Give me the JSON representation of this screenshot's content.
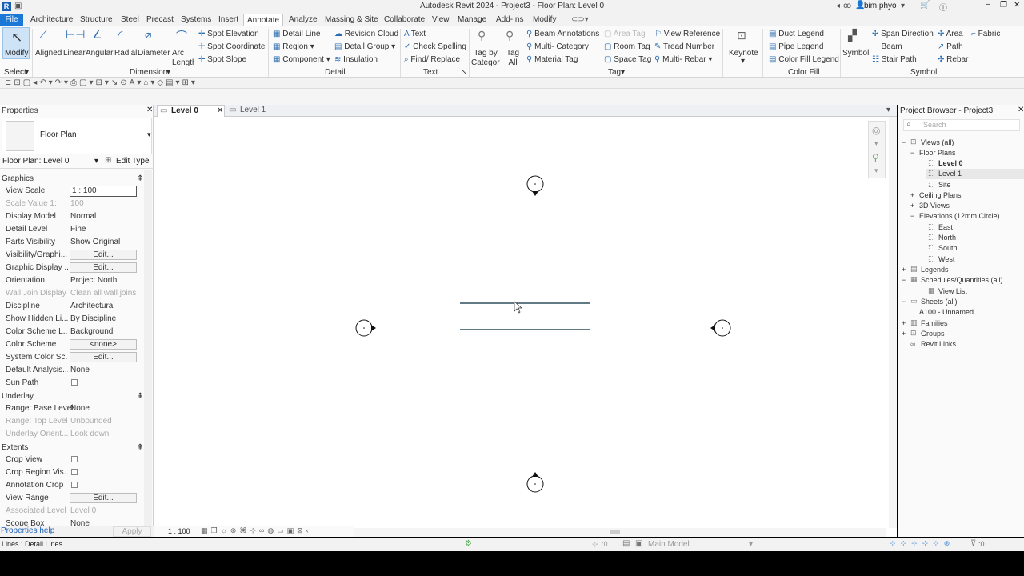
{
  "window": {
    "title": "Autodesk Revit 2024 - Project3 - Floor Plan: Level 0",
    "user": "bim.phyo"
  },
  "menu": [
    "File",
    "Architecture",
    "Structure",
    "Steel",
    "Precast",
    "Systems",
    "Insert",
    "Annotate",
    "Analyze",
    "Massing & Site",
    "Collaborate",
    "View",
    "Manage",
    "Add-Ins",
    "Modify"
  ],
  "ribbon": {
    "select_group": {
      "modify": "Modify",
      "label": "Select"
    },
    "dimension_group": {
      "items": [
        "Aligned",
        "Linear",
        "Angular",
        "Radial",
        "Diameter",
        "Arc Length"
      ],
      "spot": [
        "Spot Elevation",
        "Spot Coordinate",
        "Spot Slope"
      ],
      "label": "Dimension"
    },
    "detail_group": {
      "items": [
        "Detail Line",
        "Region",
        "Component",
        "Revision Cloud",
        "Detail Group",
        "Insulation"
      ],
      "label": "Detail"
    },
    "text_group": {
      "items": [
        "Text",
        "Check Spelling",
        "Find/ Replace"
      ],
      "label": "Text"
    },
    "tag_group": {
      "items": [
        "Tag by Category",
        "Tag All",
        "Beam Annotations",
        "Multi- Category",
        "Material Tag",
        "Area Tag",
        "Room Tag",
        "Space Tag",
        "Tread Number",
        "View Reference",
        "Multi- Rebar",
        "Keynote"
      ],
      "label": "Tag"
    },
    "colorfill_group": {
      "items": [
        "Duct Legend",
        "Pipe Legend",
        "Color Fill Legend"
      ],
      "label": "Color Fill"
    },
    "symbol_group": {
      "items": [
        "Symbol",
        "Span Direction",
        "Beam",
        "Stair Path",
        "Area",
        "Path",
        "Rebar",
        "Fabric"
      ],
      "label": "Symbol"
    }
  },
  "properties": {
    "title": "Properties",
    "type": "Floor Plan",
    "instance": "Floor Plan: Level 0",
    "edit_type": "Edit Type",
    "sections": {
      "graphics": "Graphics",
      "underlay": "Underlay",
      "extents": "Extents"
    },
    "rows": {
      "view_scale": [
        "View Scale",
        "1 : 100"
      ],
      "scale_value": [
        "Scale Value  1:",
        "100"
      ],
      "display_model": [
        "Display Model",
        "Normal"
      ],
      "detail_level": [
        "Detail Level",
        "Fine"
      ],
      "parts_visibility": [
        "Parts Visibility",
        "Show Original"
      ],
      "visibility_graphics": [
        "Visibility/Graphi...",
        "Edit..."
      ],
      "graphic_display": [
        "Graphic Display ...",
        "Edit..."
      ],
      "orientation": [
        "Orientation",
        "Project North"
      ],
      "wall_join": [
        "Wall Join Display",
        "Clean all wall joins"
      ],
      "discipline": [
        "Discipline",
        "Architectural"
      ],
      "show_hidden": [
        "Show Hidden Li...",
        "By Discipline"
      ],
      "color_scheme_loc": [
        "Color Scheme L...",
        "Background"
      ],
      "color_scheme": [
        "Color Scheme",
        "<none>"
      ],
      "system_color": [
        "System Color Sc...",
        "Edit..."
      ],
      "default_analysis": [
        "Default Analysis...",
        "None"
      ],
      "sun_path": [
        "Sun Path",
        ""
      ],
      "base_level": [
        "Range: Base Level",
        "None"
      ],
      "top_level": [
        "Range: Top Level",
        "Unbounded"
      ],
      "underlay_orient": [
        "Underlay Orient...",
        "Look down"
      ],
      "crop_view": [
        "Crop View",
        ""
      ],
      "crop_region": [
        "Crop Region Vis...",
        ""
      ],
      "annotation_crop": [
        "Annotation Crop",
        ""
      ],
      "view_range": [
        "View Range",
        "Edit..."
      ],
      "associated_level": [
        "Associated Level",
        "Level 0"
      ],
      "scope_box": [
        "Scope Box",
        "None"
      ]
    },
    "help": "Properties help",
    "apply": "Apply"
  },
  "view_tabs": [
    "Level 0",
    "Level 1"
  ],
  "view_scale_status": "1 : 100",
  "browser": {
    "title": "Project Browser - Project3",
    "search": "Search",
    "nodes": [
      "Views (all)",
      "Floor Plans",
      "Level 0",
      "Level 1",
      "Site",
      "Ceiling Plans",
      "3D Views",
      "Elevations (12mm Circle)",
      "East",
      "North",
      "South",
      "West",
      "Legends",
      "Schedules/Quantities (all)",
      "View List",
      "Sheets (all)",
      "A100 - Unnamed",
      "Families",
      "Groups",
      "Revit Links"
    ]
  },
  "status": {
    "left": "Lines : Detail Lines",
    "model": "Main Model",
    "count_a": ":0",
    "count_b": ":0"
  },
  "colors": {
    "accent": "#1b78d6",
    "line": "#2f4f5f"
  }
}
